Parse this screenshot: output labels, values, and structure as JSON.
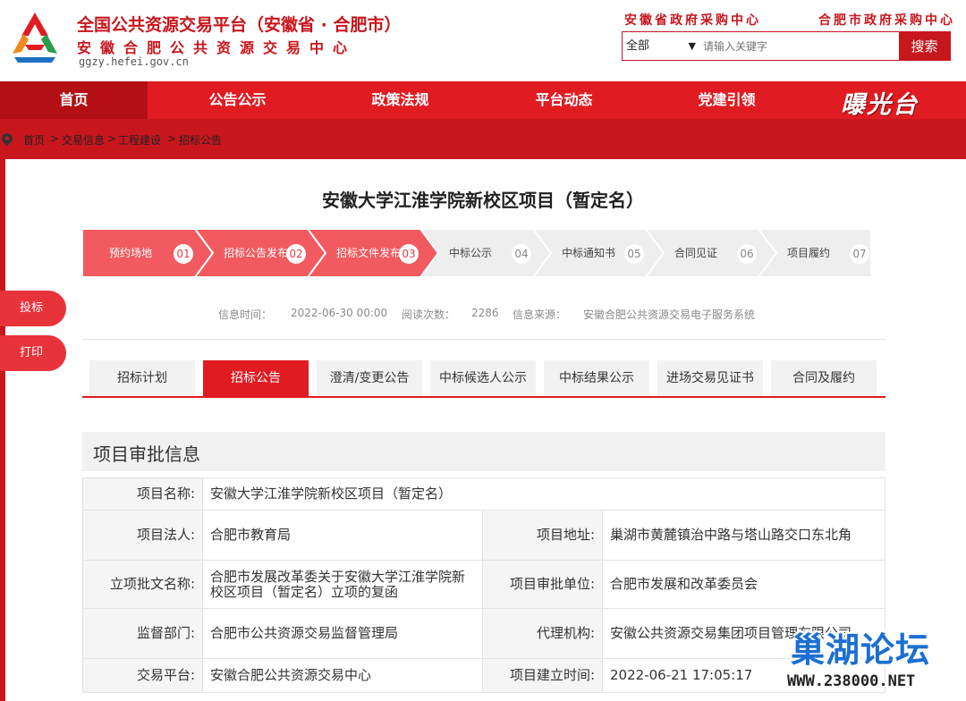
{
  "header": {
    "title_main": "全国公共资源交易平台（安徽省 · 合肥市）",
    "title_sub": "安徽合肥公共资源交易中心",
    "url": "ggzy.hefei.gov.cn",
    "link_province": "安徽省政府采购中心",
    "link_city": "合肥市政府采购中心",
    "search": {
      "scope": "全部",
      "placeholder": "请输入关键字",
      "button": "搜索"
    }
  },
  "nav": {
    "items": [
      "首页",
      "公告公示",
      "政策法规",
      "平台动态",
      "党建引领"
    ],
    "active_index": 0,
    "logo_text": "曝光台"
  },
  "breadcrumb": {
    "items": [
      "首页",
      "交易信息",
      "工程建设",
      "招标公告"
    ],
    "separator": ">"
  },
  "side": {
    "buttons": [
      "投标",
      "打印"
    ]
  },
  "main": {
    "title": "安徽大学江淮学院新校区项目（暂定名）",
    "steps": [
      {
        "label": "预约场地",
        "num": "01",
        "done": true
      },
      {
        "label": "招标公告发布",
        "num": "02",
        "done": true
      },
      {
        "label": "招标文件发布",
        "num": "03",
        "done": true
      },
      {
        "label": "中标公示",
        "num": "04",
        "done": false
      },
      {
        "label": "中标通知书",
        "num": "05",
        "done": false
      },
      {
        "label": "合同见证",
        "num": "06",
        "done": false
      },
      {
        "label": "项目履约",
        "num": "07",
        "done": false
      }
    ],
    "meta": {
      "time_label": "信息时间：",
      "time_value": "2022-06-30 00:00",
      "views_label": "阅读次数：",
      "views_value": "2286",
      "source_label": "信息来源：",
      "source_value": "安徽合肥公共资源交易电子服务系统"
    },
    "tabs": [
      "招标计划",
      "招标公告",
      "澄清/变更公告",
      "中标候选人公示",
      "中标结果公示",
      "进场交易见证书",
      "合同及履约"
    ],
    "active_tab": 1,
    "section_title": "项目审批信息",
    "table": {
      "project_name_label": "项目名称:",
      "project_name": "安徽大学江淮学院新校区项目（暂定名）",
      "legal_person_label": "项目法人:",
      "legal_person": "合肥市教育局",
      "address_label": "项目地址:",
      "address": "巢湖市黄麓镇治中路与塔山路交口东北角",
      "approval_doc_label": "立项批文名称:",
      "approval_doc": "合肥市发展改革委关于安徽大学江淮学院新校区项目（暂定名）立项的复函",
      "approval_unit_label": "项目审批单位:",
      "approval_unit": "合肥市发展和改革委员会",
      "supervisor_label": "监督部门:",
      "supervisor": "合肥市公共资源交易监督管理局",
      "agency_label": "代理机构:",
      "agency": "安徽公共资源交易集团项目管理有限公司",
      "platform_label": "交易平台:",
      "platform": "安徽合肥公共资源交易中心",
      "created_label": "项目建立时间:",
      "created": "2022-06-21 17:05:17"
    }
  },
  "watermark": {
    "text": "巢湖论坛",
    "url": "WWW.238000.NET"
  },
  "colors": {
    "brand_red": "#c8161d",
    "nav_red": "#e01b22",
    "nav_active": "#b40f14",
    "step_done": "#f05a60",
    "step_todo": "#eeeeee"
  }
}
